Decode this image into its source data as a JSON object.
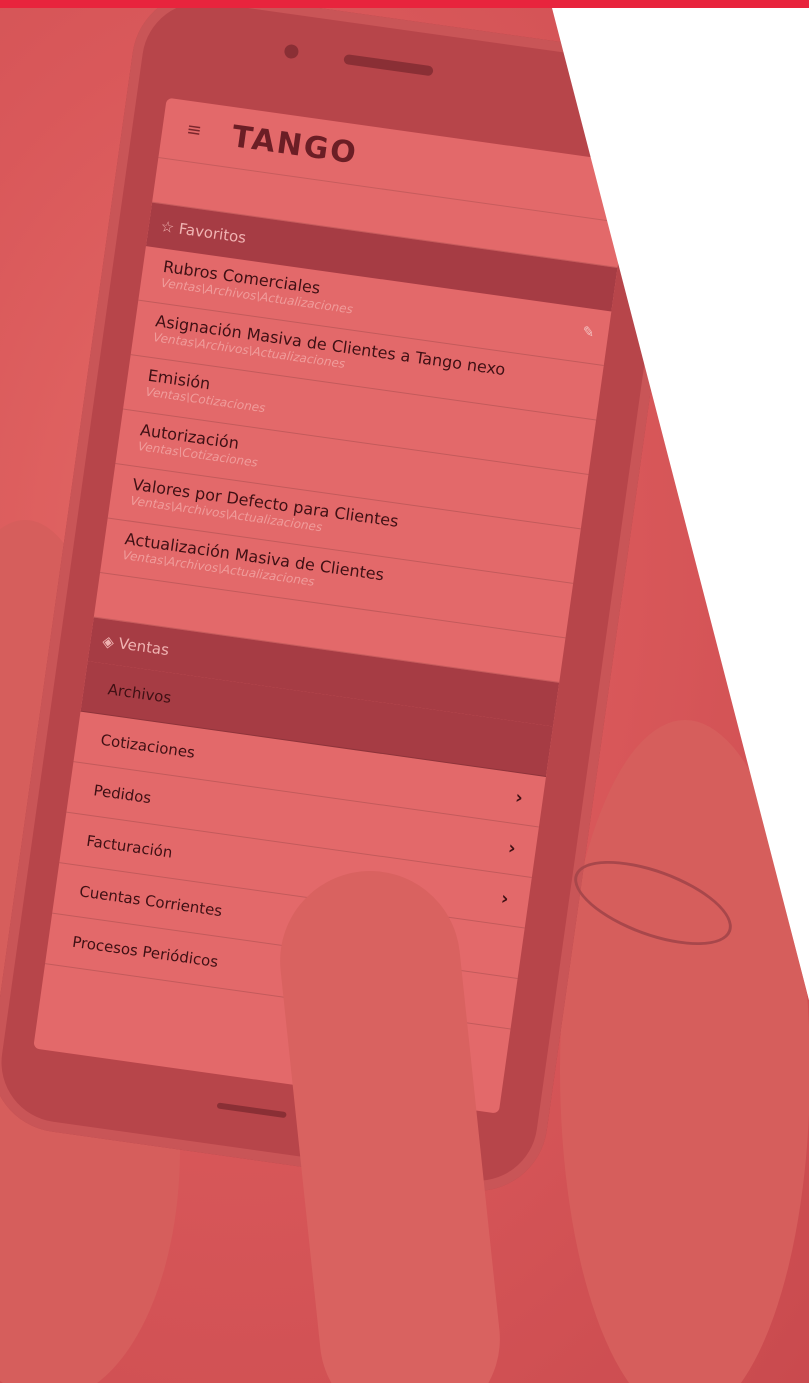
{
  "app": {
    "logo": "TANGO",
    "menu_icon": "hamburger-icon"
  },
  "favorites": {
    "header": "Favoritos",
    "header_icon": "star-icon",
    "items": [
      {
        "title": "Rubros Comerciales",
        "path": "Ventas\\Archivos\\Actualizaciones"
      },
      {
        "title": "Asignación Masiva de Clientes a Tango nexo",
        "path": "Ventas\\Archivos\\Actualizaciones"
      },
      {
        "title": "Emisión",
        "path": "Ventas\\Cotizaciones"
      },
      {
        "title": "Autorización",
        "path": "Ventas\\Cotizaciones"
      },
      {
        "title": "Valores por Defecto para Clientes",
        "path": "Ventas\\Archivos\\Actualizaciones"
      },
      {
        "title": "Actualización Masiva de Clientes",
        "path": "Ventas\\Archivos\\Actualizaciones"
      }
    ]
  },
  "ventas": {
    "header": "Ventas",
    "header_icon": "tag-icon",
    "items": [
      {
        "label": "Archivos"
      },
      {
        "label": "Cotizaciones"
      },
      {
        "label": "Pedidos"
      },
      {
        "label": "Facturación"
      },
      {
        "label": "Cuentas Corrientes"
      },
      {
        "label": "Procesos Periódicos"
      }
    ]
  },
  "colors": {
    "overlay": "#d9585a",
    "accent_bar": "#e8243d",
    "section_bg": "#a63c44"
  }
}
